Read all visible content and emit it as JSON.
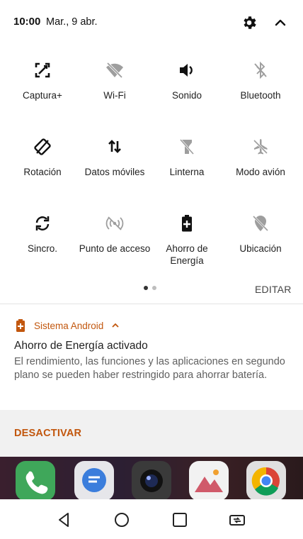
{
  "status_bar": {
    "time": "10:00",
    "date": "Mar., 9 abr."
  },
  "quick_settings": {
    "tiles": [
      {
        "label": "Captura+",
        "icon": "capture-plus-icon",
        "active": true
      },
      {
        "label": "Wi-Fi",
        "icon": "wifi-off-icon",
        "active": false
      },
      {
        "label": "Sonido",
        "icon": "volume-icon",
        "active": true
      },
      {
        "label": "Bluetooth",
        "icon": "bluetooth-off-icon",
        "active": false
      },
      {
        "label": "Rotación",
        "icon": "rotation-icon",
        "active": true
      },
      {
        "label": "Datos móviles",
        "icon": "mobile-data-icon",
        "active": true
      },
      {
        "label": "Linterna",
        "icon": "flashlight-off-icon",
        "active": false
      },
      {
        "label": "Modo avión",
        "icon": "airplane-off-icon",
        "active": false
      },
      {
        "label": "Sincro.",
        "icon": "sync-icon",
        "active": true
      },
      {
        "label": "Punto de acceso",
        "icon": "hotspot-off-icon",
        "active": false
      },
      {
        "label": "Ahorro de Energía",
        "icon": "battery-saver-icon",
        "active": true
      },
      {
        "label": "Ubicación",
        "icon": "location-off-icon",
        "active": false
      }
    ],
    "page_count": 2,
    "current_page": 1,
    "edit_label": "EDITAR"
  },
  "notification": {
    "app_name": "Sistema Android",
    "title": "Ahorro de Energía activado",
    "body": "El rendimiento, las funciones y las aplicaciones en segundo plano se pueden haber restringido para ahorrar batería.",
    "action_label": "DESACTIVAR",
    "accent_color": "#c2570e"
  },
  "dock": {
    "apps": [
      {
        "icon": "phone-app-icon",
        "color": "#3fa75a"
      },
      {
        "icon": "messages-app-icon",
        "color": "#3b7ddc"
      },
      {
        "icon": "camera-app-icon",
        "color": "#2b2b2b"
      },
      {
        "icon": "gallery-app-icon",
        "color": "#d05a6a"
      },
      {
        "icon": "chrome-app-icon",
        "color": "#e0e0e0"
      }
    ]
  },
  "navigation": {
    "buttons": [
      "back-icon",
      "home-icon",
      "recents-icon",
      "dual-window-icon"
    ]
  },
  "colors": {
    "active_icon": "#111111",
    "inactive_icon": "#9e9e9e",
    "page_dot_active": "#333333",
    "page_dot_inactive": "#bdbdbd"
  }
}
